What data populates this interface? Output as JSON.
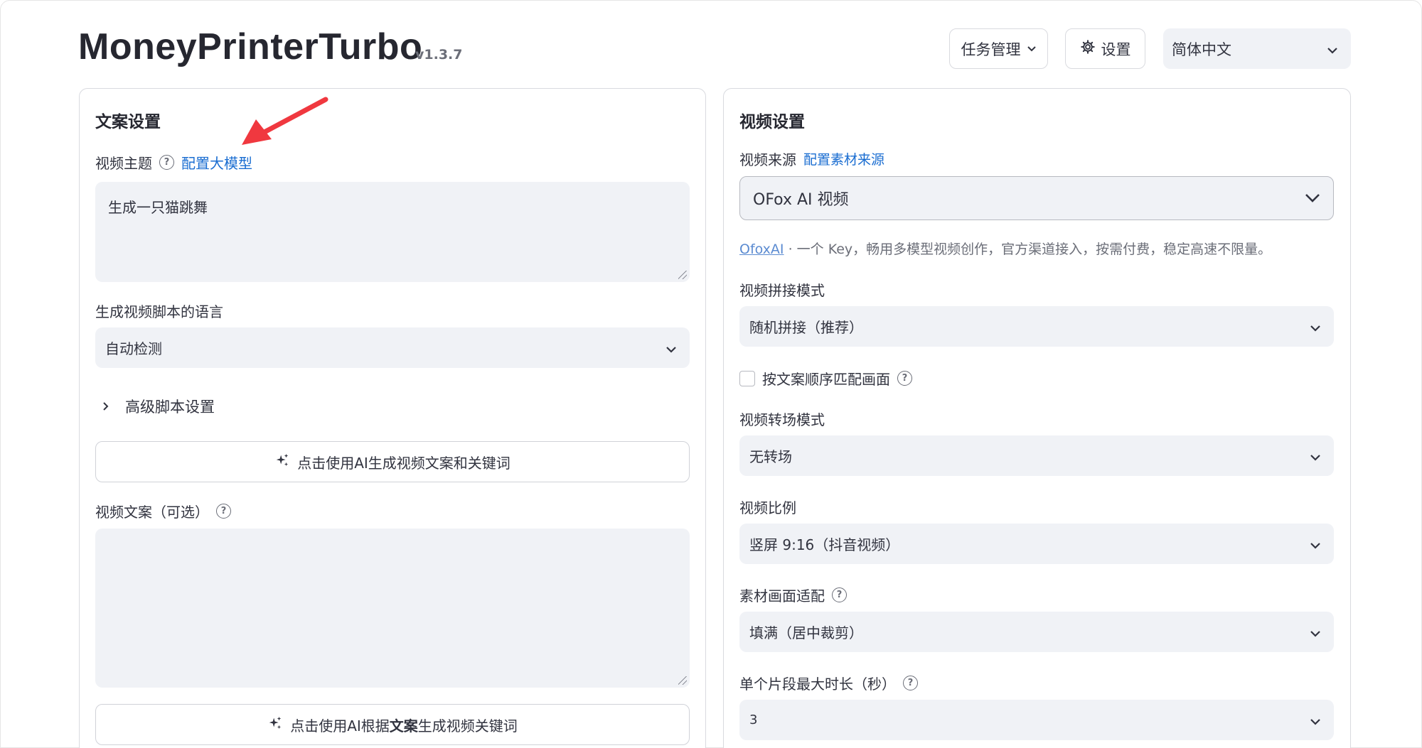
{
  "header": {
    "title": "MoneyPrinterTurbo",
    "version": "v1.3.7",
    "task_button": "任务管理",
    "settings_button": "设置",
    "language_select": "简体中文"
  },
  "left_panel": {
    "title": "文案设置",
    "subject_label": "视频主题",
    "configure_llm_link": "配置大模型",
    "subject_value": "生成一只猫跳舞",
    "script_language_label": "生成视频脚本的语言",
    "script_language_value": "自动检测",
    "advanced_label": "高级脚本设置",
    "generate_script_button": "点击使用AI生成视频文案和关键词",
    "script_label": "视频文案（可选）",
    "script_value": "",
    "generate_terms_prefix": "点击使用AI根据",
    "generate_terms_bold": "文案",
    "generate_terms_suffix": "生成视频关键词"
  },
  "right_panel": {
    "title": "视频设置",
    "source_label": "视频来源",
    "configure_source_link": "配置素材来源",
    "source_value": "OFox AI 视频",
    "source_caption_link": "OfoxAI",
    "source_caption_text": " · 一个 Key，畅用多模型视频创作，官方渠道接入，按需付费，稳定高速不限量。",
    "concat_label": "视频拼接模式",
    "concat_value": "随机拼接（推荐）",
    "match_checkbox_label": "按文案顺序匹配画面",
    "transition_label": "视频转场模式",
    "transition_value": "无转场",
    "aspect_label": "视频比例",
    "aspect_value": "竖屏 9:16（抖音视频）",
    "fit_label": "素材画面适配",
    "fit_value": "填满（居中裁剪）",
    "clip_duration_label": "单个片段最大时长（秒）",
    "clip_duration_value": "3"
  },
  "annotation": {
    "arrow_color": "#f0383f"
  }
}
